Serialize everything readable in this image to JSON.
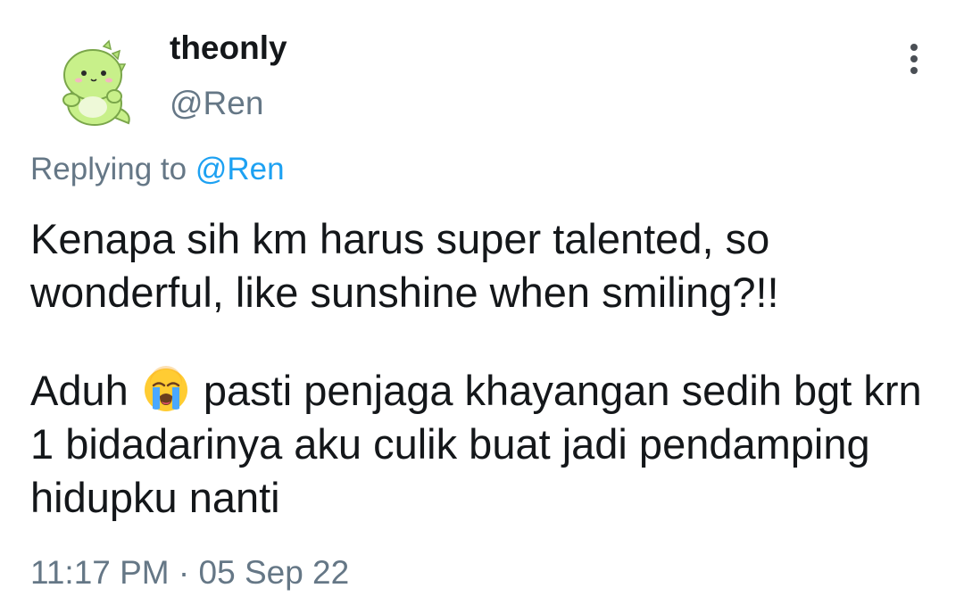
{
  "tweet": {
    "display_name": "theonly",
    "handle": "@Ren",
    "avatar_icon": "green-dinosaur-avatar",
    "reply_prefix": "Replying to ",
    "reply_to": "@Ren",
    "paragraph_1": "Kenapa sih km harus super talented, so wonderful, like sunshine when smiling?!!",
    "paragraph_2_before_emoji": "Aduh ",
    "paragraph_2_emoji": "loudly-crying-face-emoji",
    "paragraph_2_after_emoji": " pasti penjaga khayangan sedih bgt krn 1 bidadarinya aku culik buat jadi pendamping hidupku nanti",
    "timestamp": "11:17 PM · 05 Sep 22"
  },
  "colors": {
    "text_primary": "#14171a",
    "text_secondary": "#657786",
    "mention": "#1da1f2",
    "avatar_green": "#c8f08a"
  }
}
